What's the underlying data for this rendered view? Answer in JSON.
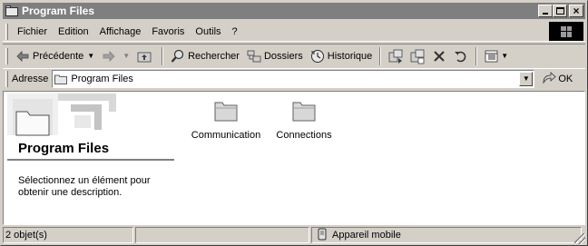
{
  "window": {
    "title": "Program Files"
  },
  "menu": {
    "items": [
      "Fichier",
      "Edition",
      "Affichage",
      "Favoris",
      "Outils",
      "?"
    ]
  },
  "toolbar": {
    "back_label": "Précédente",
    "search_label": "Rechercher",
    "folders_label": "Dossiers",
    "history_label": "Historique"
  },
  "address": {
    "label": "Adresse",
    "value": "Program Files",
    "go_label": "OK"
  },
  "webview": {
    "title": "Program Files",
    "description": "Sélectionnez un élément pour obtenir une description."
  },
  "files": [
    {
      "name": "Communication",
      "icon": "folder-icon"
    },
    {
      "name": "Connections",
      "icon": "folder-icon"
    }
  ],
  "status": {
    "count": "2 objet(s)",
    "zone": "Appareil mobile"
  }
}
